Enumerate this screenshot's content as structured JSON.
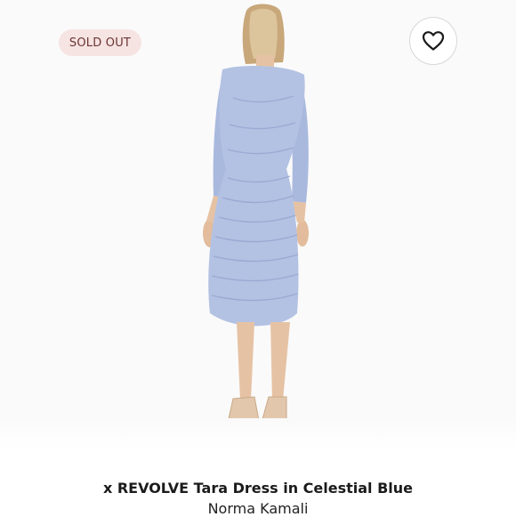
{
  "listing": {
    "badge": "SOLD OUT",
    "title": "x REVOLVE Tara Dress in Celestial Blue",
    "brand": "Norma Kamali"
  },
  "carousel": {
    "total": 3,
    "active_index": 2
  },
  "icons": {
    "like": "heart-outline-icon"
  },
  "colors": {
    "dress": "#b3c2e3",
    "badge_bg": "#f6e4e3",
    "badge_text": "#6b3432"
  }
}
